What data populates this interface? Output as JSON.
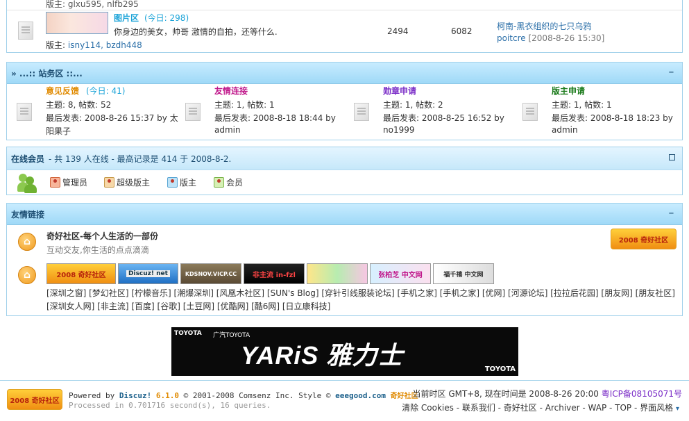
{
  "forum": {
    "moderators_top": "版主: glxu595, nlfb295",
    "name": "图片区",
    "today": "(今日: 298)",
    "desc": "你身边的美女，帅哥 激情的自拍，还等什么.",
    "moderators_label": "版主:",
    "moderators": "isny114, bzdh448",
    "topics": "2494",
    "posts": "6082",
    "last_title": "柯南-黑衣组织的七只乌鸦",
    "last_user": "poitcre",
    "last_time": "[2008-8-26 15:30]"
  },
  "category": {
    "title": "» ...:: 站务区 ::...",
    "collapse": "−",
    "forums": [
      {
        "name": "意见反馈",
        "today": "(今日: 41)",
        "color": "#e08a00",
        "stats": "主题: 8, 帖数: 52",
        "last1": "最后发表: 2008-8-26 15:37 by 太",
        "last2": "阳果子"
      },
      {
        "name": "友情连接",
        "today": "",
        "color": "#c0168a",
        "stats": "主题: 1, 帖数: 1",
        "last1": "最后发表: 2008-8-18 18:44 by",
        "last2": "admin"
      },
      {
        "name": "勋章申请",
        "today": "",
        "color": "#7a2cc7",
        "stats": "主题: 1, 帖数: 2",
        "last1": "最后发表: 2008-8-25 16:52 by",
        "last2": "no1999"
      },
      {
        "name": "版主申请",
        "today": "",
        "color": "#1a7a1a",
        "stats": "主题: 1, 帖数: 1",
        "last1": "最后发表: 2008-8-18 18:23 by",
        "last2": "admin"
      }
    ]
  },
  "online": {
    "title": "在线会员",
    "summary": "- 共  139 人在线  - 最高记录是  414 于  2008-8-2.",
    "legend": [
      "管理员",
      "超级版主",
      "版主",
      "会员"
    ]
  },
  "links": {
    "title": "友情链接",
    "site_name": "奇好社区-每个人生活的一部份",
    "site_desc": "互动交友,你生活的点点滴滴",
    "logo_text": "2008 奇好社区 eeegood.com",
    "banners": [
      "2008 奇好社区",
      "Discuz! net",
      "KDSNOV.VICP.CC",
      "非主流 in-fzl",
      "",
      "张柏芝 中文网",
      "福千禧 中文网"
    ],
    "text_links": "[深圳之窗] [梦幻社区] [柠檬音乐] [潮爆深圳] [风凰木社区] [SUN's Blog] [穿针引线服装论坛] [手机之家] [手机之家] [优网] [河源论坛] [拉拉后花园] [朋友网] [朋友社区] [深圳女人网] [非主流] [百度] [谷歌] [土豆网] [优酷网] [酷6网] [日立康科技]"
  },
  "ad": {
    "brand": "TOYOTA",
    "partner": "广汽TOYOTA",
    "headline": "YARiS 雅力士",
    "brand2": "TOYOTA"
  },
  "footer": {
    "powered": "Powered by",
    "discuz": "Discuz!",
    "version": "6.1.0",
    "copyright": "© 2001-2008 Comsenz Inc. Style ©",
    "style_site": "eeegood.com",
    "style_name": "奇好社区",
    "processed": "Processed in 0.701716 second(s), 16 queries.",
    "timezone": "当前时区  GMT+8, 现在时间是  2008-8-26 20:00",
    "icp": "粤ICP备08105071号",
    "links": "清除  Cookies - 联系我们  - 奇好社区  - Archiver - WAP - TOP - 界面风格"
  }
}
